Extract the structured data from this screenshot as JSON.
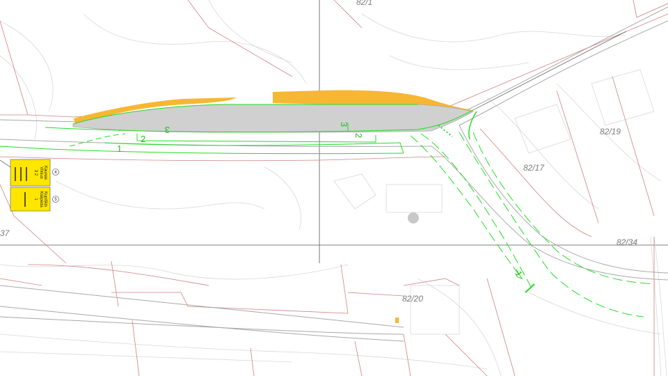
{
  "parcels": [
    "82/1",
    "82/19",
    "82/17",
    "82/34",
    "82/20",
    "37"
  ],
  "lanes": [
    "1",
    "2",
    "3",
    "3",
    "2",
    "1"
  ],
  "signs": [
    {
      "badge": "4",
      "destinations": [
        "Vilnius",
        "Kaunas"
      ],
      "lanes": "3 2"
    },
    {
      "badge": "5",
      "destinations": [
        "Klaipėda",
        "Kupiškis"
      ],
      "lanes": "1"
    }
  ],
  "colors": {
    "fill_area": "#f7b733",
    "road_surface": "#d0d0d0",
    "lane_marking": "#22dd22",
    "parcel_boundary": "#d08080",
    "sign": "#ffe600"
  }
}
